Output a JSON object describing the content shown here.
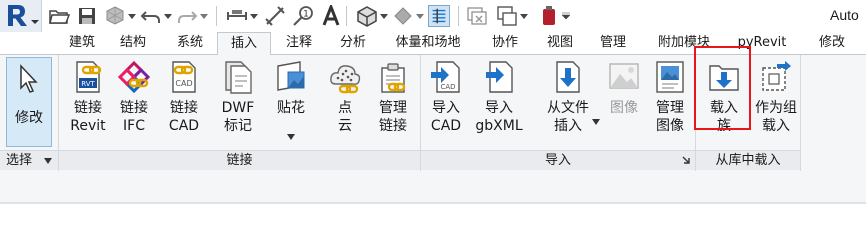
{
  "window": {
    "title": "Auto"
  },
  "qat": {
    "icons": [
      "app-menu-icon",
      "open-icon",
      "save-icon",
      "sync-icon",
      "undo-icon",
      "redo-icon",
      "measure-icon",
      "dimension-icon",
      "tag-icon",
      "text-icon",
      "3d-view-icon",
      "section-icon",
      "thin-lines-icon",
      "close-hidden-icon",
      "switch-windows-icon",
      "family-icon"
    ]
  },
  "tabs": [
    {
      "label": "建筑"
    },
    {
      "label": "结构"
    },
    {
      "label": "系统"
    },
    {
      "label": "插入",
      "active": true
    },
    {
      "label": "注释"
    },
    {
      "label": "分析"
    },
    {
      "label": "体量和场地"
    },
    {
      "label": "协作"
    },
    {
      "label": "视图"
    },
    {
      "label": "管理"
    },
    {
      "label": "附加模块"
    },
    {
      "label": "pyRevit"
    },
    {
      "label": "修改"
    }
  ],
  "panels": {
    "select": {
      "title": "选择",
      "modify_label": "修改"
    },
    "link": {
      "title": "链接",
      "buttons": [
        {
          "line1": "链接",
          "line2": "Revit"
        },
        {
          "line1": "链接",
          "line2": "IFC"
        },
        {
          "line1": "链接",
          "line2": "CAD"
        },
        {
          "line1": "DWF",
          "line2": "标记"
        },
        {
          "line1": "贴花",
          "line2": ""
        },
        {
          "line1": "点",
          "line2": "云"
        },
        {
          "line1": "管理",
          "line2": "链接"
        }
      ]
    },
    "import": {
      "title": "导入",
      "buttons": [
        {
          "line1": "导入",
          "line2": "CAD"
        },
        {
          "line1": "导入",
          "line2": "gbXML"
        },
        {
          "line1": "从文件",
          "line2": "插入"
        },
        {
          "line1": "图像",
          "line2": "",
          "disabled": true
        },
        {
          "line1": "管理",
          "line2": "图像"
        }
      ]
    },
    "load_from_library": {
      "title": "从库中载入",
      "buttons": [
        {
          "line1": "载入",
          "line2": "族"
        },
        {
          "line1": "作为组",
          "line2": "载入"
        }
      ]
    }
  },
  "colors": {
    "accent_blue": "#1e73c8",
    "link_gold": "#e0a400",
    "highlight_red": "#e8161b",
    "active_bg": "#d5e9f7"
  }
}
